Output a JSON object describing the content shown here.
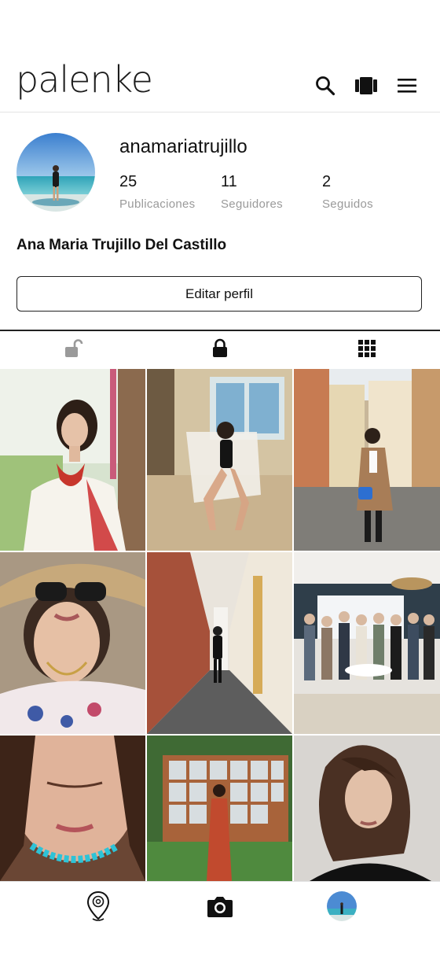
{
  "app": {
    "logo": "palenke"
  },
  "header": {
    "icons": [
      "search-icon",
      "cards-icon",
      "menu-icon"
    ]
  },
  "profile": {
    "username": "anamariatrujillo",
    "full_name": "Ana Maria Trujillo Del Castillo",
    "stats": [
      {
        "value": "25",
        "label": "Publicaciones"
      },
      {
        "value": "11",
        "label": "Seguidores"
      },
      {
        "value": "2",
        "label": "Seguidos"
      }
    ],
    "edit_button": "Editar perfil"
  },
  "tabs": [
    "unlock-icon",
    "lock-icon",
    "grid-icon"
  ],
  "posts": [
    {
      "name": "post-white-blouse-coral-necklace"
    },
    {
      "name": "post-black-swimsuit-white-chair"
    },
    {
      "name": "post-street-camel-coat"
    },
    {
      "name": "post-straw-hat-floral-top"
    },
    {
      "name": "post-brick-corridor"
    },
    {
      "name": "post-family-gathering"
    },
    {
      "name": "post-turquoise-necklace-selfie"
    },
    {
      "name": "post-red-dress-window"
    },
    {
      "name": "post-portrait-hair"
    }
  ],
  "bottom_nav": [
    "map-pin-icon",
    "camera-icon",
    "profile-avatar"
  ]
}
